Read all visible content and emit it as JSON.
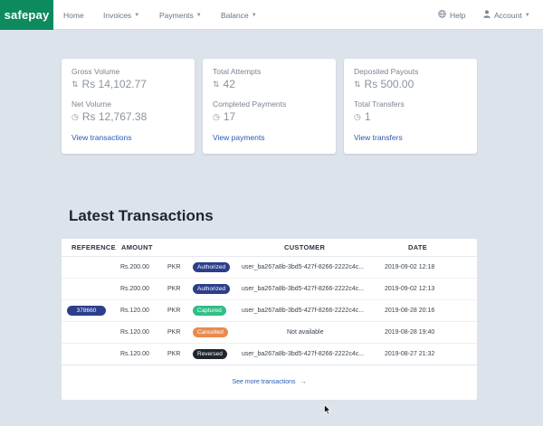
{
  "nav": {
    "brand": "safepay",
    "items": [
      {
        "label": "Home",
        "caret": false
      },
      {
        "label": "Invoices",
        "caret": true
      },
      {
        "label": "Payments",
        "caret": true
      },
      {
        "label": "Balance",
        "caret": true
      }
    ],
    "help_label": "Help",
    "account_label": "Account"
  },
  "cards": [
    {
      "stats": [
        {
          "label": "Gross Volume",
          "value": "Rs 14,102.77",
          "icon": "transfer-icon"
        },
        {
          "label": "Net Volume",
          "value": "Rs 12,767.38",
          "icon": "clock-icon"
        }
      ],
      "link": "View transactions"
    },
    {
      "stats": [
        {
          "label": "Total Attempts",
          "value": "42",
          "icon": "transfer-icon"
        },
        {
          "label": "Completed Payments",
          "value": "17",
          "icon": "clock-icon"
        }
      ],
      "link": "View payments"
    },
    {
      "stats": [
        {
          "label": "Deposited Payouts",
          "value": "Rs 500.00",
          "icon": "transfer-icon"
        },
        {
          "label": "Total Transfers",
          "value": "1",
          "icon": "clock-icon"
        }
      ],
      "link": "View transfers"
    }
  ],
  "transactions": {
    "title": "Latest Transactions",
    "columns": {
      "reference": "REFERENCE",
      "amount": "AMOUNT",
      "customer": "CUSTOMER",
      "date": "DATE"
    },
    "rows": [
      {
        "reference": "",
        "amount": "Rs.200.00",
        "currency": "PKR",
        "status": "Authorized",
        "status_color": "#2c3f8c",
        "customer": "user_ba267a8b-3bd5-427f-8266-2222c4c...",
        "date": "2019-09-02 12:18"
      },
      {
        "reference": "",
        "amount": "Rs.200.00",
        "currency": "PKR",
        "status": "Authorized",
        "status_color": "#2c3f8c",
        "customer": "user_ba267a8b-3bd5-427f-8266-2222c4c...",
        "date": "2019-09-02 12:13"
      },
      {
        "reference": "378660",
        "amount": "Rs.120.00",
        "currency": "PKR",
        "status": "Captured",
        "status_color": "#2fbf87",
        "customer": "user_ba267a8b-3bd5-427f-8266-2222c4c...",
        "date": "2019-08-28 20:16"
      },
      {
        "reference": "",
        "amount": "Rs.120.00",
        "currency": "PKR",
        "status": "Cancelled",
        "status_color": "#e98a50",
        "customer": "Not available",
        "date": "2019-08-28 19:40"
      },
      {
        "reference": "",
        "amount": "Rs.120.00",
        "currency": "PKR",
        "status": "Reversed",
        "status_color": "#1f2630",
        "customer": "user_ba267a8b-3bd5-427f-8266-2222c4c...",
        "date": "2019-08-27 21:32"
      }
    ],
    "more_label": "See more transactions"
  }
}
